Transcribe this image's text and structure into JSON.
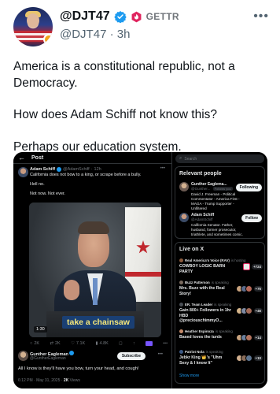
{
  "post": {
    "display_name": "@DJT47",
    "platform": "GETTR",
    "handle": "@DJT47",
    "time_ago": "3h",
    "paragraphs": [
      "America is a constitutional republic, not a Democracy.",
      "How does Adam Schiff not know this?",
      "Perhaps our education system."
    ]
  },
  "embed": {
    "topbar_title": "Post",
    "tweet": {
      "author_name": "Adam Schiff",
      "author_handle": "@AdamSchiff",
      "time": "12h",
      "lines": [
        "California does not bow to a king, or scrape before a bully.",
        "Hell no.",
        "Not now. Not ever."
      ],
      "video_caption": "take a chainsaw",
      "video_duration": "1:30",
      "actions": {
        "replies": "2K",
        "reposts": "2K",
        "likes": "7.1K",
        "views": "4.8K"
      }
    },
    "reply": {
      "author_name": "Gunther Eagleman",
      "author_handle": "@GuntherEagleman",
      "subscribe_label": "Subscribe",
      "text": "All I know is they'll have you bow, turn your head, and cough!",
      "timestamp": "6:12 PM · May 31, 2025 ·",
      "views": "2K",
      "views_label": "Views"
    },
    "search_placeholder": "Search",
    "relevant_people": {
      "title": "Relevant people",
      "people": [
        {
          "name": "Gunther Eaglema...",
          "handle": "@Gunther...",
          "follows_you": "Follows you",
          "bio": "David J. Freeman - Political Commentator - America First - MAGA - Trump Supporter - Unfiltered",
          "button": "Following",
          "color": "#6b5a52"
        },
        {
          "name": "Adam Schiff",
          "handle": "@AdamSchiff",
          "bio": "California Senator. Father, husband, former prosecutor, triathlete, and sometimes comic.",
          "button": "Follow",
          "color": "#3b4b66"
        }
      ]
    },
    "live": {
      "title": "Live on X",
      "items": [
        {
          "host": "Real America's Voice (RAV)",
          "status": "is hosting",
          "title": "COWBOY LOGIC BARN PARTY",
          "count": "+724"
        },
        {
          "host": "Buzz Patterson",
          "status": "is speaking",
          "title": "Mrs. Buzz with the Real Story!",
          "count": "+75"
        },
        {
          "host": "ER. Team Leader",
          "status": "is speaking",
          "title": "Gain 800+ Followers in 1hr HBD @preciouschimmyO...",
          "count": "+46"
        },
        {
          "host": "Heather Espinoza",
          "status": "is speaking",
          "title": "Based loves the turds",
          "count": "+14"
        },
        {
          "host": "Patriot Nola",
          "status": "is speaking",
          "title": "Jebkr King 👑's \"Uhm Sexy & I know It\"",
          "count": "+10"
        }
      ],
      "show_more": "Show more"
    }
  },
  "colors": {
    "verified": "#1d9bf0",
    "premium": "#e0245e",
    "accent": "#1d9bf0"
  }
}
